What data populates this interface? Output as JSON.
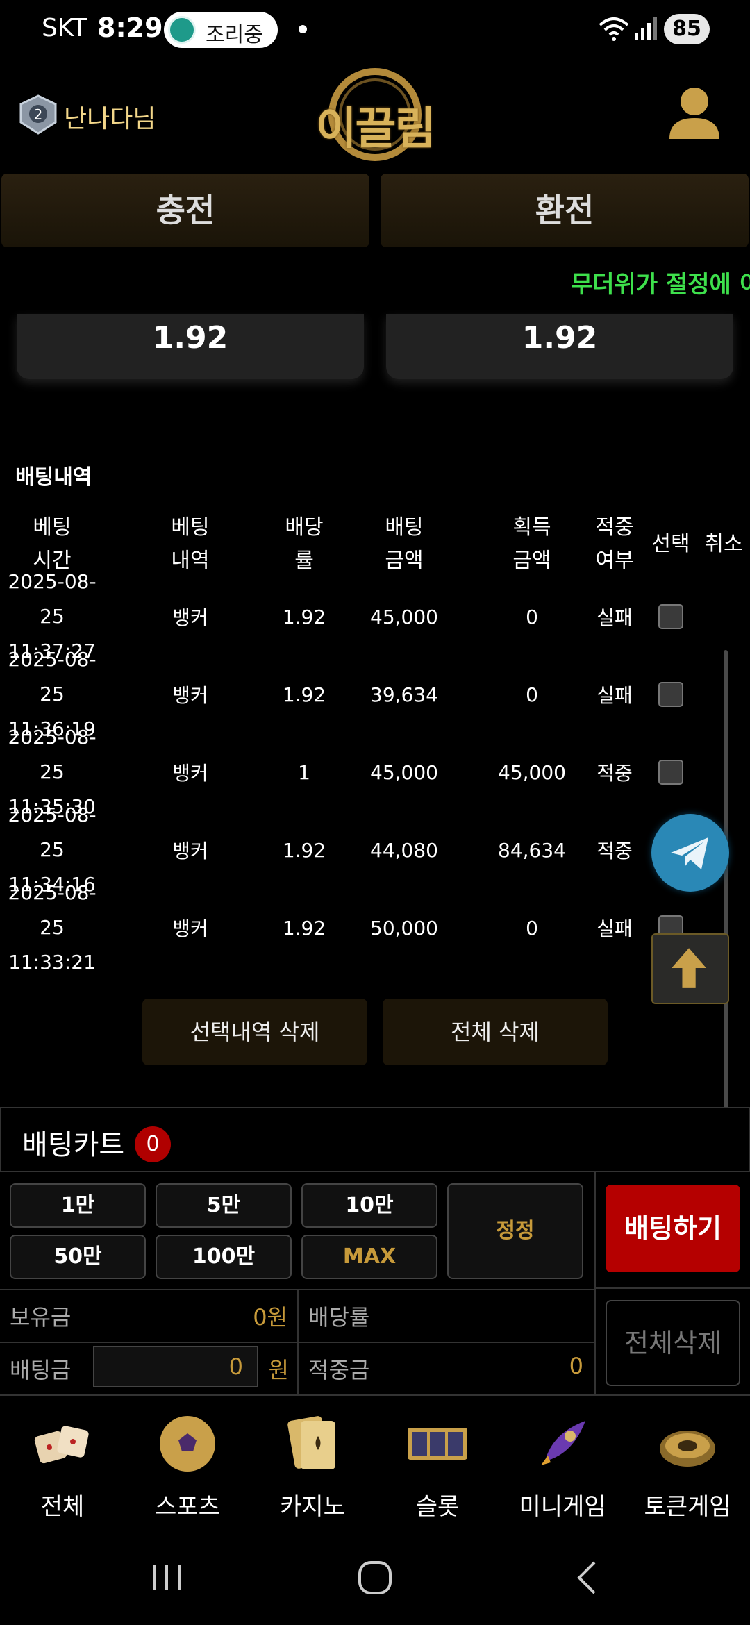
{
  "status_bar": {
    "carrier": "SKT",
    "time": "8:29",
    "chip_label": "조리중",
    "battery": "85"
  },
  "header": {
    "username": "난나다님",
    "logo_text": "이끌림"
  },
  "actions": {
    "charge": "충전",
    "exchange": "환전"
  },
  "ticker": "무더위가 절정에 이",
  "odds_cards": [
    "1.92",
    "1.92"
  ],
  "history": {
    "title": "배팅내역",
    "columns": [
      {
        "l1": "베팅",
        "l2": "시간"
      },
      {
        "l1": "베팅",
        "l2": "내역"
      },
      {
        "l1": "배당",
        "l2": "률"
      },
      {
        "l1": "배팅",
        "l2": "금액"
      },
      {
        "l1": "획득",
        "l2": "금액"
      },
      {
        "l1": "적중",
        "l2": "여부"
      },
      {
        "l1": "선택",
        "l2": ""
      },
      {
        "l1": "취소",
        "l2": ""
      }
    ],
    "rows": [
      {
        "date": "2025-08-25",
        "time": "11:37:27",
        "pick": "뱅커",
        "odds": "1.92",
        "stake": "45,000",
        "win": "0",
        "result": "실패"
      },
      {
        "date": "2025-08-25",
        "time": "11:36:19",
        "pick": "뱅커",
        "odds": "1.92",
        "stake": "39,634",
        "win": "0",
        "result": "실패"
      },
      {
        "date": "2025-08-25",
        "time": "11:35:30",
        "pick": "뱅커",
        "odds": "1",
        "stake": "45,000",
        "win": "45,000",
        "result": "적중"
      },
      {
        "date": "2025-08-25",
        "time": "11:34:16",
        "pick": "뱅커",
        "odds": "1.92",
        "stake": "44,080",
        "win": "84,634",
        "result": "적중"
      },
      {
        "date": "2025-08-25",
        "time": "11:33:21",
        "pick": "뱅커",
        "odds": "1.92",
        "stake": "50,000",
        "win": "0",
        "result": "실패"
      }
    ],
    "delete_selected": "선택내역 삭제",
    "delete_all": "전체 삭제"
  },
  "cart": {
    "title": "배팅카트",
    "count": "0",
    "chips": [
      "1만",
      "5만",
      "10만",
      "50만",
      "100만",
      "MAX"
    ],
    "reset": "정정",
    "bet_button": "배팅하기",
    "clear_button": "전체삭제",
    "balance_label": "보유금",
    "balance_value": "0원",
    "odds_label": "배당률",
    "odds_value": "",
    "stake_label": "배팅금",
    "stake_value": "0",
    "stake_unit": "원",
    "payout_label": "적중금",
    "payout_value": "0"
  },
  "game_nav": [
    {
      "label": "전체",
      "icon": "dice-icon"
    },
    {
      "label": "스포츠",
      "icon": "soccer-ball-icon"
    },
    {
      "label": "카지노",
      "icon": "cards-icon"
    },
    {
      "label": "슬롯",
      "icon": "slot-777-icon"
    },
    {
      "label": "미니게임",
      "icon": "rocket-icon"
    },
    {
      "label": "토큰게임",
      "icon": "roulette-icon"
    }
  ],
  "colors": {
    "accent_gold": "#c79a3a",
    "ticker_green": "#3ee04c",
    "bet_red": "#b50000"
  }
}
